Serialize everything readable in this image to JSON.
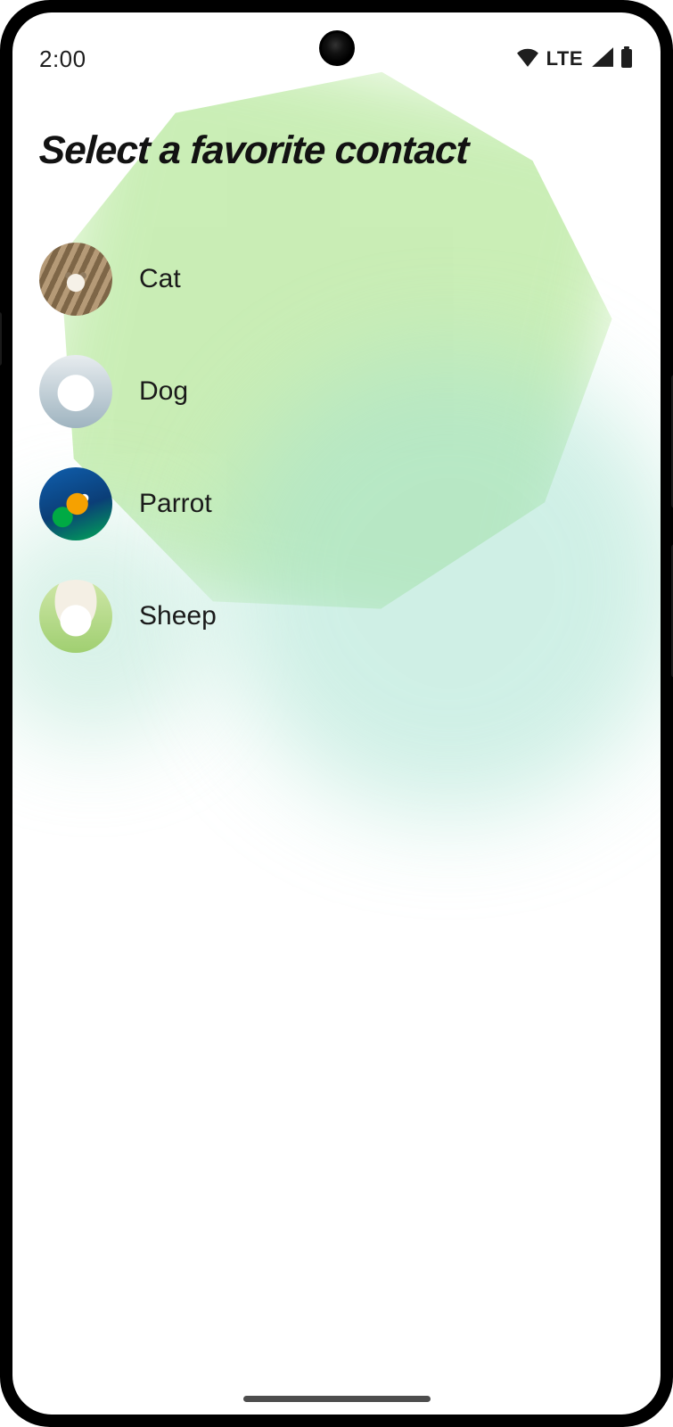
{
  "status_bar": {
    "time": "2:00",
    "network_label": "LTE"
  },
  "page": {
    "title": "Select a favorite contact"
  },
  "contacts": {
    "items": [
      {
        "label": "Cat",
        "avatar_name": "cat-avatar",
        "avatar_class": "av-cat"
      },
      {
        "label": "Dog",
        "avatar_name": "dog-avatar",
        "avatar_class": "av-dog"
      },
      {
        "label": "Parrot",
        "avatar_name": "parrot-avatar",
        "avatar_class": "av-parrot"
      },
      {
        "label": "Sheep",
        "avatar_name": "sheep-avatar",
        "avatar_class": "av-sheep"
      }
    ]
  }
}
